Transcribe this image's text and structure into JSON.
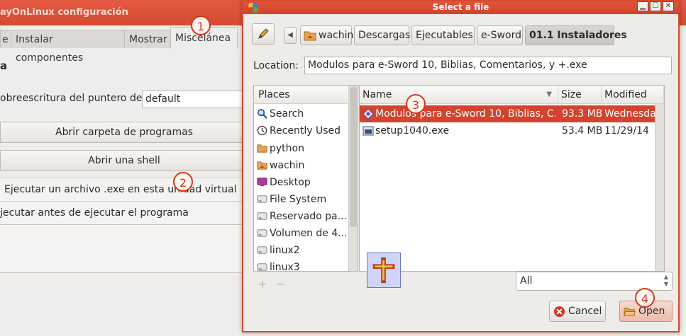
{
  "background_window": {
    "title": "ayOnLinux configuración",
    "tabs": [
      {
        "label": "e",
        "active": false
      },
      {
        "label": "Instalar componentes",
        "active": false
      },
      {
        "label": "Mostrar",
        "active": false
      },
      {
        "label": "Miscelánea",
        "active": true
      }
    ],
    "section_heading": "a",
    "cursor_label": "obreescritura del puntero del",
    "cursor_value": "default",
    "buttons": [
      "Abrir carpeta de programas",
      "Abrir una shell"
    ],
    "list_rows": [
      "Ejecutar un archivo .exe en esta unidad virtual",
      "jecutar antes de ejecutar el programa"
    ]
  },
  "annotations": [
    "1",
    "2",
    "3",
    "4"
  ],
  "dialog": {
    "title": "Select a file",
    "breadcrumbs": [
      "wachin",
      "Descargas",
      "Ejecutables",
      "e-Sword",
      "01.1 Instaladores"
    ],
    "location_label": "Location:",
    "location_value": "Modulos para e-Sword 10, Biblias, Comentarios, y +.exe",
    "places_header": "Places",
    "places": [
      {
        "label": "Search",
        "icon": "search-icon"
      },
      {
        "label": "Recently Used",
        "icon": "clock-icon"
      },
      {
        "label": "python",
        "icon": "folder-icon"
      },
      {
        "label": "wachin",
        "icon": "home-folder-icon"
      },
      {
        "label": "Desktop",
        "icon": "desktop-icon"
      },
      {
        "label": "File System",
        "icon": "drive-icon"
      },
      {
        "label": "Reservado pa...",
        "icon": "drive-icon"
      },
      {
        "label": "Volumen de 4...",
        "icon": "drive-icon"
      },
      {
        "label": "linux2",
        "icon": "drive-icon"
      },
      {
        "label": "linux3",
        "icon": "drive-icon"
      }
    ],
    "columns": {
      "name": "Name",
      "size": "Size",
      "modified": "Modified"
    },
    "files": [
      {
        "name": "Modulos para e-Sword 10, Biblias, C...",
        "size": "93.3 MB",
        "modified": "Wednesday",
        "selected": true
      },
      {
        "name": "setup1040.exe",
        "size": "53.4 MB",
        "modified": "11/29/14",
        "selected": false
      }
    ],
    "add_remove": [
      "+",
      "−"
    ],
    "filter": "All",
    "cancel_label": "Cancel",
    "open_label": "Open"
  },
  "colors": {
    "accent": "#d4432d",
    "titlebar": "#d64a32"
  }
}
